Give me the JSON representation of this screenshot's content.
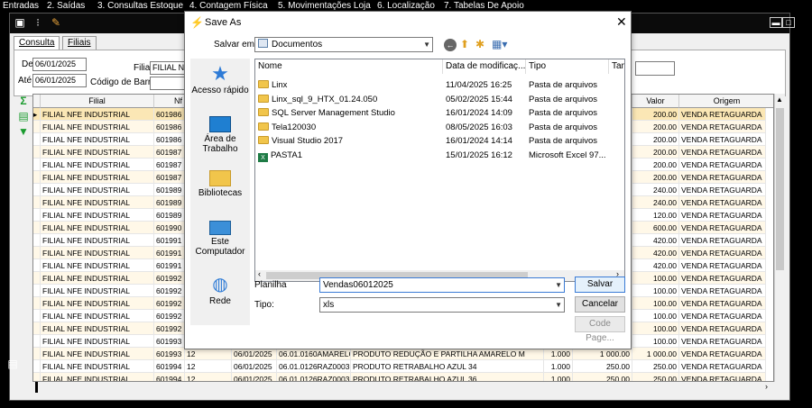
{
  "menu": [
    "Entradas",
    "2. Saídas",
    "3. Consultas Estoque",
    "4. Contagem Física",
    "5. Movimentações Loja",
    "6. Localização",
    "7. Tabelas De Apoio"
  ],
  "tabs": {
    "consulta": "Consulta",
    "filiais": "Filiais"
  },
  "filters": {
    "de_label": "De",
    "de_value": "06/01/2025",
    "ate_label": "Até",
    "ate_value": "06/01/2025",
    "filial_label": "Filial",
    "filial_value": "FILIAL NF",
    "codigo_label": "Código de Barras"
  },
  "grid": {
    "headers": {
      "filial": "Filial",
      "nf": "Nf",
      "valor": "Valor",
      "origem": "Origem"
    },
    "rows": [
      {
        "filial": "FILIAL NFE INDUSTRIAL",
        "nf": "601986",
        "valor": "200.00",
        "origem": "VENDA RETAGUARDA"
      },
      {
        "filial": "FILIAL NFE INDUSTRIAL",
        "nf": "601986",
        "valor": "200.00",
        "origem": "VENDA RETAGUARDA"
      },
      {
        "filial": "FILIAL NFE INDUSTRIAL",
        "nf": "601986",
        "valor": "200.00",
        "origem": "VENDA RETAGUARDA"
      },
      {
        "filial": "FILIAL NFE INDUSTRIAL",
        "nf": "601987",
        "valor": "200.00",
        "origem": "VENDA RETAGUARDA"
      },
      {
        "filial": "FILIAL NFE INDUSTRIAL",
        "nf": "601987",
        "valor": "200.00",
        "origem": "VENDA RETAGUARDA"
      },
      {
        "filial": "FILIAL NFE INDUSTRIAL",
        "nf": "601987",
        "valor": "200.00",
        "origem": "VENDA RETAGUARDA"
      },
      {
        "filial": "FILIAL NFE INDUSTRIAL",
        "nf": "601989",
        "valor": "240.00",
        "origem": "VENDA RETAGUARDA"
      },
      {
        "filial": "FILIAL NFE INDUSTRIAL",
        "nf": "601989",
        "valor": "240.00",
        "origem": "VENDA RETAGUARDA"
      },
      {
        "filial": "FILIAL NFE INDUSTRIAL",
        "nf": "601989",
        "valor": "120.00",
        "origem": "VENDA RETAGUARDA"
      },
      {
        "filial": "FILIAL NFE INDUSTRIAL",
        "nf": "601990",
        "valor": "600.00",
        "origem": "VENDA RETAGUARDA"
      },
      {
        "filial": "FILIAL NFE INDUSTRIAL",
        "nf": "601991",
        "valor": "420.00",
        "origem": "VENDA RETAGUARDA"
      },
      {
        "filial": "FILIAL NFE INDUSTRIAL",
        "nf": "601991",
        "valor": "420.00",
        "origem": "VENDA RETAGUARDA"
      },
      {
        "filial": "FILIAL NFE INDUSTRIAL",
        "nf": "601991",
        "valor": "420.00",
        "origem": "VENDA RETAGUARDA"
      },
      {
        "filial": "FILIAL NFE INDUSTRIAL",
        "nf": "601992",
        "valor": "100.00",
        "origem": "VENDA RETAGUARDA"
      },
      {
        "filial": "FILIAL NFE INDUSTRIAL",
        "nf": "601992",
        "valor": "100.00",
        "origem": "VENDA RETAGUARDA"
      },
      {
        "filial": "FILIAL NFE INDUSTRIAL",
        "nf": "601992",
        "valor": "100.00",
        "origem": "VENDA RETAGUARDA"
      },
      {
        "filial": "FILIAL NFE INDUSTRIAL",
        "nf": "601992",
        "valor": "100.00",
        "origem": "VENDA RETAGUARDA"
      },
      {
        "filial": "FILIAL NFE INDUSTRIAL",
        "nf": "601992",
        "valor": "100.00",
        "origem": "VENDA RETAGUARDA"
      },
      {
        "filial": "FILIAL NFE INDUSTRIAL",
        "nf": "601993",
        "valor": "100.00",
        "origem": "VENDA RETAGUARDA"
      },
      {
        "filial": "FILIAL NFE INDUSTRIAL",
        "nf": "601993",
        "c3": "12",
        "data": "06/01/2025",
        "ref": "06.01.0160AMARELO",
        "prod": "PRODUTO REDUÇÃO E PARTILHA AMARELO M",
        "qtd": "1.000",
        "unit": "1 000.00",
        "valor": "1 000.00",
        "origem": "VENDA RETAGUARDA"
      },
      {
        "filial": "FILIAL NFE INDUSTRIAL",
        "nf": "601994",
        "c3": "12",
        "data": "06/01/2025",
        "ref": "06.01.0126RAZ0003",
        "prod": "PRODUTO RETRABALHO AZUL 34",
        "qtd": "1.000",
        "unit": "250.00",
        "valor": "250.00",
        "origem": "VENDA RETAGUARDA"
      },
      {
        "filial": "FILIAL NFE INDUSTRIAL",
        "nf": "601994",
        "c3": "12",
        "data": "06/01/2025",
        "ref": "06.01.0126RAZ0003",
        "prod": "PRODUTO RETRABALHO AZUL 36",
        "qtd": "1.000",
        "unit": "250.00",
        "valor": "250.00",
        "origem": "VENDA RETAGUARDA"
      }
    ]
  },
  "dialog": {
    "title": "Save As",
    "save_in_label": "Salvar em:",
    "save_in_value": "Documentos",
    "places": [
      "Acesso rápido",
      "Área de Trabalho",
      "Bibliotecas",
      "Este Computador",
      "Rede"
    ],
    "columns": {
      "name": "Nome",
      "date": "Data de modificaç...",
      "type": "Tipo",
      "size": "Tam"
    },
    "files": [
      {
        "name": "Linx",
        "date": "11/04/2025 16:25",
        "type": "Pasta de arquivos",
        "kind": "folder"
      },
      {
        "name": "Linx_sql_9_HTX_01.24.050",
        "date": "05/02/2025 15:44",
        "type": "Pasta de arquivos",
        "kind": "folder"
      },
      {
        "name": "SQL Server Management Studio",
        "date": "16/01/2024 14:09",
        "type": "Pasta de arquivos",
        "kind": "folder"
      },
      {
        "name": "Tela120030",
        "date": "08/05/2025 16:03",
        "type": "Pasta de arquivos",
        "kind": "folder"
      },
      {
        "name": "Visual Studio 2017",
        "date": "16/01/2024 14:14",
        "type": "Pasta de arquivos",
        "kind": "folder"
      },
      {
        "name": "PASTA1",
        "date": "15/01/2025 16:12",
        "type": "Microsoft Excel 97...",
        "kind": "xls"
      }
    ],
    "filename_label": "Planilha",
    "filename_value": "Vendas06012025",
    "type_label": "Tipo:",
    "type_value": "xls",
    "save_button": "Salvar",
    "cancel_button": "Cancelar",
    "codepage_button": "Code Page..."
  }
}
